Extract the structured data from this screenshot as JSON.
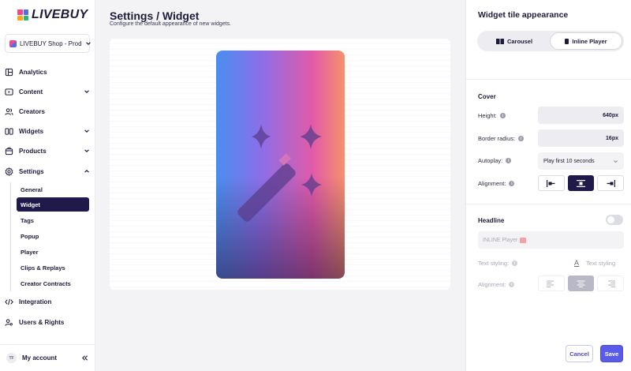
{
  "brand": {
    "name": "LIVEBUY",
    "logo_colors": [
      "#e84c8a",
      "#4e6fe8",
      "#f5a623",
      "#2bb673"
    ]
  },
  "shop": {
    "name": "LIVEBUY Shop - Prod"
  },
  "nav": {
    "items": [
      {
        "label": "Analytics",
        "icon": "chart-icon"
      },
      {
        "label": "Content",
        "icon": "play-icon",
        "chevron": "down"
      },
      {
        "label": "Creators",
        "icon": "users-icon"
      },
      {
        "label": "Widgets",
        "icon": "widgets-icon",
        "chevron": "down"
      },
      {
        "label": "Products",
        "icon": "bag-icon",
        "chevron": "down"
      },
      {
        "label": "Settings",
        "icon": "gear-icon",
        "chevron": "up"
      },
      {
        "label": "Integration",
        "icon": "code-icon"
      },
      {
        "label": "Users & Rights",
        "icon": "user-key-icon"
      }
    ],
    "settings_sub": [
      "General",
      "Widget",
      "Tags",
      "Popup",
      "Player",
      "Clips & Replays",
      "Creator Contracts"
    ],
    "active_sub": "Widget"
  },
  "account": {
    "initials": "TF",
    "label": "My account"
  },
  "page": {
    "title": "Settings / Widget",
    "subtitle": "Configure the default appearance of new widgets."
  },
  "panel": {
    "title": "Widget tile appearance",
    "tabs": [
      {
        "label": "Carousel",
        "active": false
      },
      {
        "label": "Inline Player",
        "active": true
      }
    ],
    "cover": {
      "title": "Cover",
      "height_label": "Height:",
      "height_value": "640px",
      "radius_label": "Border radius:",
      "radius_value": "16px",
      "autoplay_label": "Autoplay:",
      "autoplay_value": "Play first 10 seconds",
      "alignment_label": "Alignment:",
      "alignment_selected": "center"
    },
    "headline": {
      "title": "Headline",
      "enabled": false,
      "text_value": "INLINE Player",
      "text_styling_label": "Text styling:",
      "text_styling_button": "Text styling",
      "alignment_label": "Alignment:",
      "alignment_selected": "center"
    },
    "actions": {
      "cancel": "Cancel",
      "save": "Save"
    }
  },
  "colors": {
    "accent": "#5b5bea",
    "active_nav": "#1f1a4a"
  }
}
